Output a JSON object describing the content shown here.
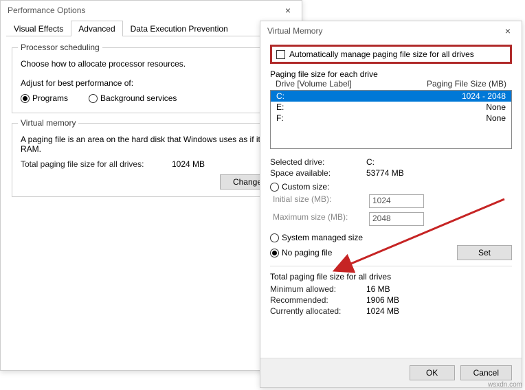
{
  "perf": {
    "title": "Performance Options",
    "tabs": {
      "visual": "Visual Effects",
      "advanced": "Advanced",
      "dep": "Data Execution Prevention"
    },
    "sched": {
      "title": "Processor scheduling",
      "desc": "Choose how to allocate processor resources.",
      "adjust": "Adjust for best performance of:",
      "programs": "Programs",
      "bg": "Background services"
    },
    "vm": {
      "title": "Virtual memory",
      "desc": "A paging file is an area on the hard disk that Windows uses as if it were RAM.",
      "total_label": "Total paging file size for all drives:",
      "total_value": "1024 MB",
      "change": "Change..."
    }
  },
  "vm_dialog": {
    "title": "Virtual Memory",
    "auto": "Automatically manage paging file size for all drives",
    "each": "Paging file size for each drive",
    "col_drive": "Drive  [Volume Label]",
    "col_size": "Paging File Size (MB)",
    "drives": [
      {
        "d": "C:",
        "s": "1024 - 2048"
      },
      {
        "d": "E:",
        "s": "None"
      },
      {
        "d": "F:",
        "s": "None"
      }
    ],
    "sel_drive_label": "Selected drive:",
    "sel_drive_value": "C:",
    "space_label": "Space available:",
    "space_value": "53774 MB",
    "custom": "Custom size:",
    "initial_label": "Initial size (MB):",
    "initial_value": "1024",
    "max_label": "Maximum size (MB):",
    "max_value": "2048",
    "sys_managed": "System managed size",
    "no_paging": "No paging file",
    "set": "Set",
    "totals_title": "Total paging file size for all drives",
    "min_label": "Minimum allowed:",
    "min_value": "16 MB",
    "rec_label": "Recommended:",
    "rec_value": "1906 MB",
    "cur_label": "Currently allocated:",
    "cur_value": "1024 MB",
    "ok": "OK",
    "cancel": "Cancel"
  },
  "watermark": "wsxdn.com"
}
